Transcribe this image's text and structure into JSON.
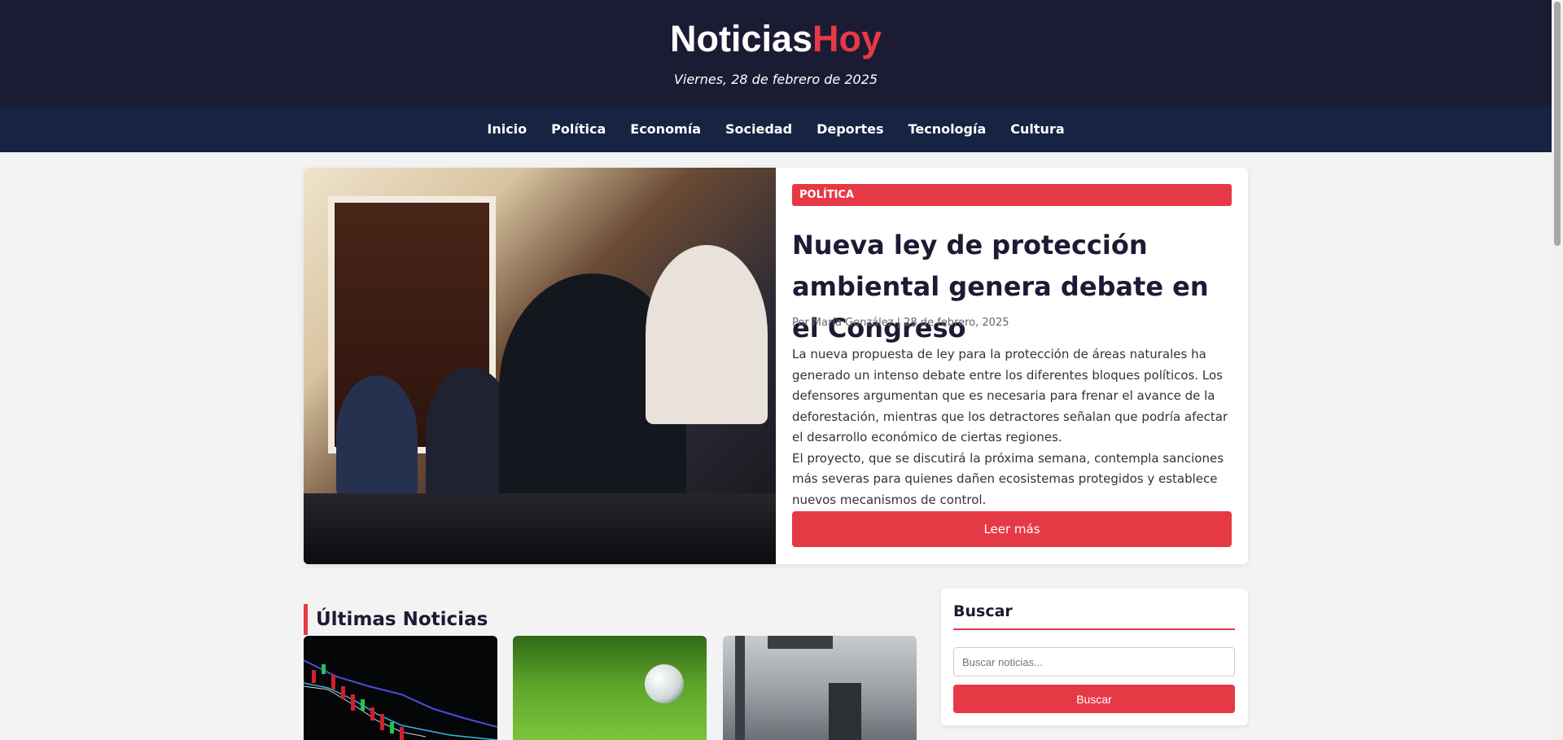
{
  "header": {
    "logo_part1": "Noticias",
    "logo_part2": "Hoy",
    "date": "Viernes, 28 de febrero de 2025",
    "colors": {
      "background": "#1c1b34",
      "accent": "#e63946",
      "nav_background": "#172342"
    }
  },
  "nav": {
    "items": [
      {
        "label": "Inicio"
      },
      {
        "label": "Política"
      },
      {
        "label": "Economía"
      },
      {
        "label": "Sociedad"
      },
      {
        "label": "Deportes"
      },
      {
        "label": "Tecnología"
      },
      {
        "label": "Cultura"
      }
    ]
  },
  "featured": {
    "category": "POLÍTICA",
    "title": "Nueva ley de protección ambiental genera debate en el Congreso",
    "meta": "Por María González | 28 de febrero, 2025",
    "paragraph1": "La nueva propuesta de ley para la protección de áreas naturales ha generado un intenso debate entre los diferentes bloques políticos. Los defensores argumentan que es necesaria para frenar el avance de la deforestación, mientras que los detractores señalan que podría afectar el desarrollo económico de ciertas regiones.",
    "paragraph2": "El proyecto, que se discutirá la próxima semana, contempla sanciones más severas para quienes dañen ecosistemas protegidos y establece nuevos mecanismos de control.",
    "read_more": "Leer más"
  },
  "latest": {
    "title": "Últimas Noticias"
  },
  "search": {
    "title": "Buscar",
    "placeholder": "Buscar noticias...",
    "button": "Buscar"
  }
}
